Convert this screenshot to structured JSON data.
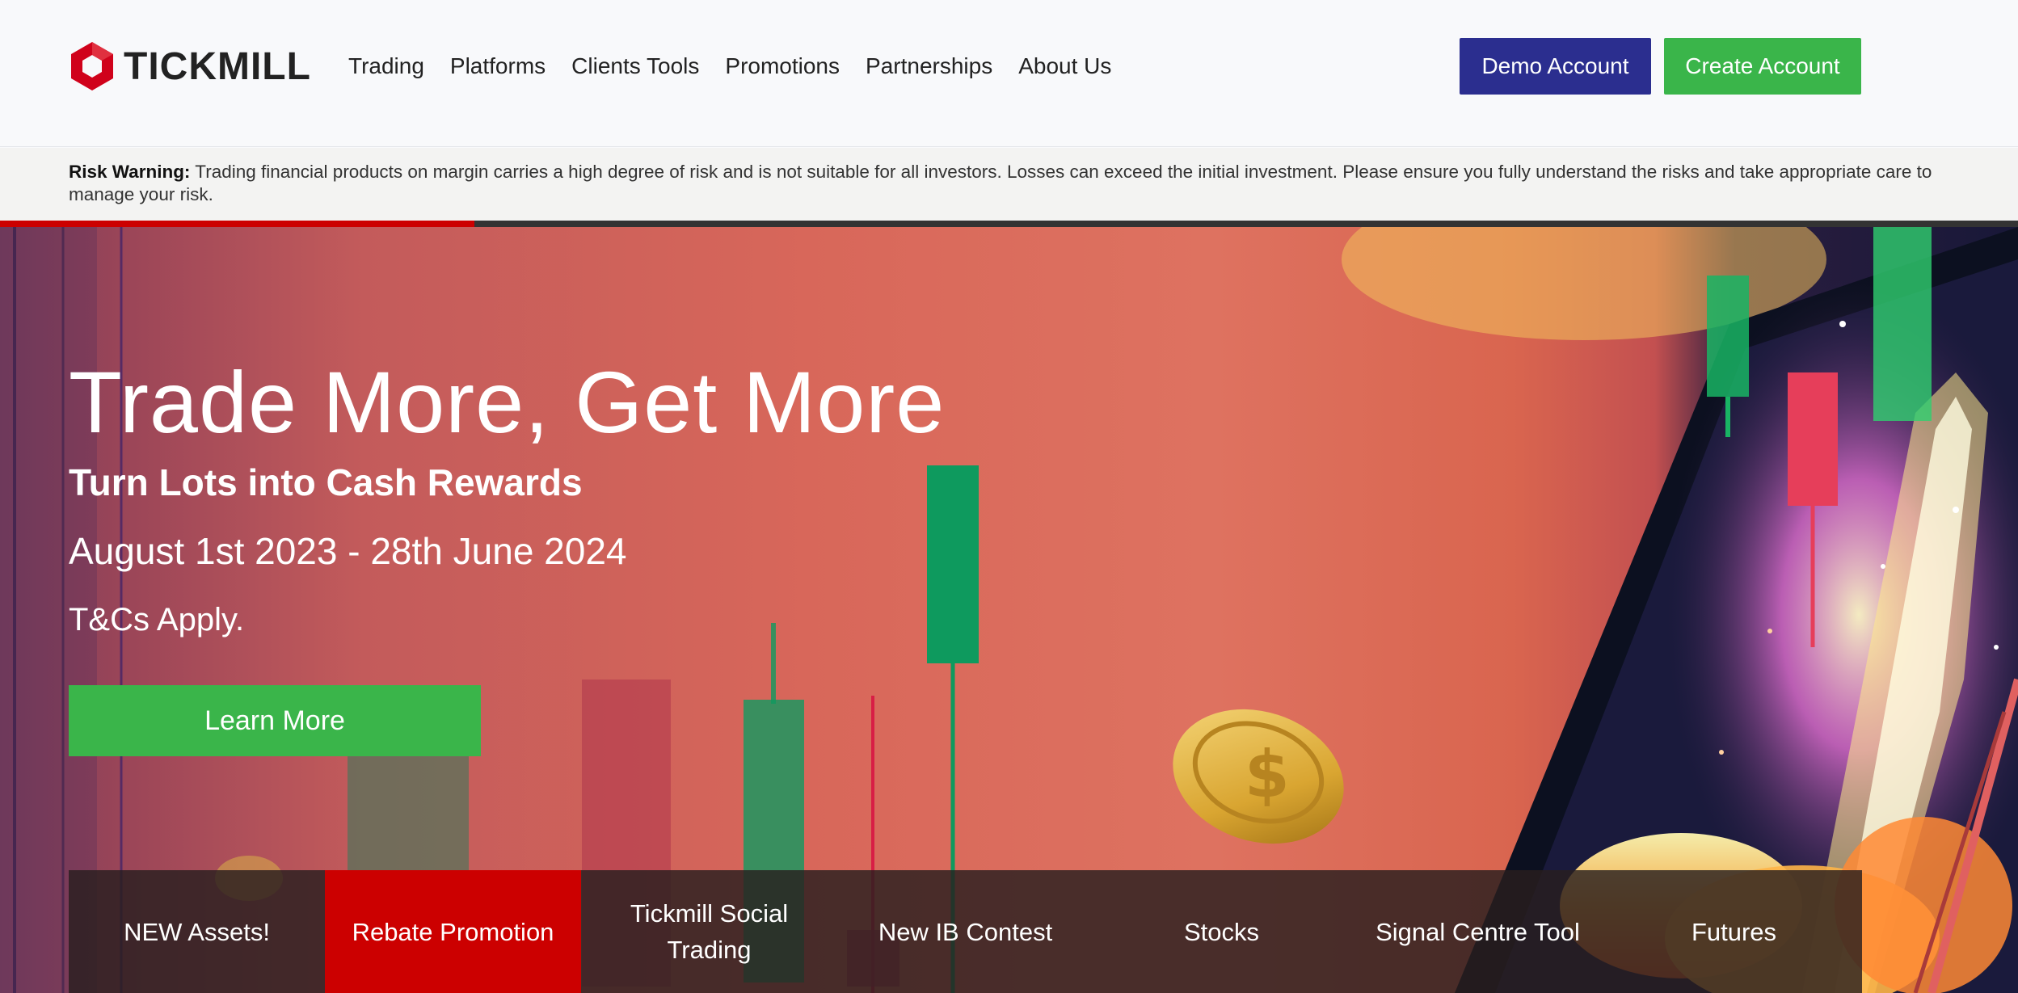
{
  "header": {
    "logo_text": "TICKMILL",
    "nav": [
      "Trading",
      "Platforms",
      "Clients Tools",
      "Promotions",
      "Partnerships",
      "About Us"
    ],
    "demo_button": "Demo Account",
    "create_button": "Create Account"
  },
  "risk_warning": {
    "label": "Risk Warning:",
    "text": "Trading financial products on margin carries a high degree of risk and is not suitable for all investors. Losses can exceed the initial investment. Please ensure you fully understand the risks and take appropriate care to manage your risk."
  },
  "slider": {
    "progress_fraction": 0.235
  },
  "hero": {
    "title": "Trade More, Get More",
    "subtitle": "Turn Lots into Cash Rewards",
    "dates": "August 1st 2023 - 28th June 2024",
    "terms": "T&Cs Apply.",
    "cta": "Learn More"
  },
  "tabs": [
    {
      "label": "NEW Assets!",
      "active": false
    },
    {
      "label": "Rebate Promotion",
      "active": true
    },
    {
      "label": "Tickmill Social Trading",
      "active": false
    },
    {
      "label": "New IB Contest",
      "active": false
    },
    {
      "label": "Stocks",
      "active": false
    },
    {
      "label": "Signal Centre Tool",
      "active": false
    },
    {
      "label": "Futures",
      "active": false
    }
  ],
  "colors": {
    "brand_red": "#cc0000",
    "demo_blue": "#2b2e8f",
    "action_green": "#3ab54a"
  }
}
